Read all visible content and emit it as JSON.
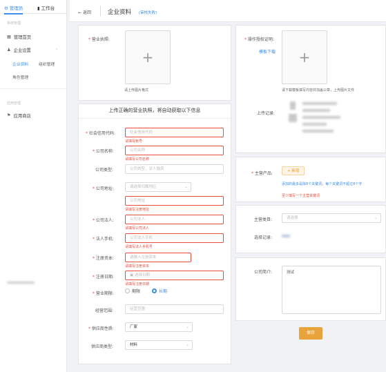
{
  "sidebar": {
    "tabs": [
      "管理员",
      "工作台"
    ],
    "section1": "系统管理",
    "items": [
      "管理首页",
      "企业设置"
    ],
    "subitems": [
      "企业资料",
      "组织管理",
      "角色管理"
    ],
    "section2": "应用管理",
    "app_item": "应用商店"
  },
  "header": {
    "back": "返回",
    "title": "企业资料",
    "status": "(审核失败)"
  },
  "license": {
    "label": "营业执照:",
    "hint": "请上传图片格式"
  },
  "auth": {
    "label": "操作授权证明:",
    "template_link": "模板下载",
    "hint": "请下载模板填写内容并加盖公章，上传图片文件"
  },
  "upload_log": {
    "label": "上传记录:"
  },
  "form": {
    "title": "上传正确的营业执照，将自动获取以下信息",
    "credit": {
      "label": "社会信用代码:",
      "placeholder": "社会信用代码",
      "error": "请填写账号"
    },
    "name": {
      "label": "公司名称:",
      "placeholder": "公司名称",
      "error": "请填写公司名称"
    },
    "type": {
      "label": "公司类型:",
      "placeholder": "公司类型，法人独资"
    },
    "address": {
      "label": "公司地址:",
      "select_placeholder": "请选择归属地区",
      "placeholder": "公司地址",
      "error": "请填写注册地址"
    },
    "legal": {
      "label": "公司法人:",
      "placeholder": "公司法人",
      "error": "请填写公司法人"
    },
    "phone": {
      "label": "法人手机:",
      "placeholder": "公司法人手机",
      "error": "请填写法人手机号"
    },
    "capital": {
      "label": "注册资本:",
      "placeholder": "请输入注册资本",
      "error": "请填写注册资本"
    },
    "date": {
      "label": "注册日期:",
      "placeholder": "选择日期",
      "error": "请填写注册日期"
    },
    "period": {
      "label": "营业期限:",
      "option1": "期限",
      "option2": "长期"
    },
    "scope": {
      "label": "经营范围:",
      "placeholder": "经营范围"
    },
    "supplier_nature": {
      "label": "供应商性质:",
      "value": "厂家"
    },
    "supplier_type": {
      "label": "供应商类型:",
      "value": "材料"
    }
  },
  "products": {
    "label": "主营产品:",
    "tag": "+ 新增",
    "hint1": "添加的最多是除8个关键词，每个关键词不超过8个字",
    "hint2": "至少填写一个主营关键词"
  },
  "category": {
    "label": "主营类目:",
    "placeholder": "请选择"
  },
  "select_log": {
    "label": "选择记录:"
  },
  "intro": {
    "label": "公司简介:",
    "value": "测试"
  },
  "save_button": "保存"
}
